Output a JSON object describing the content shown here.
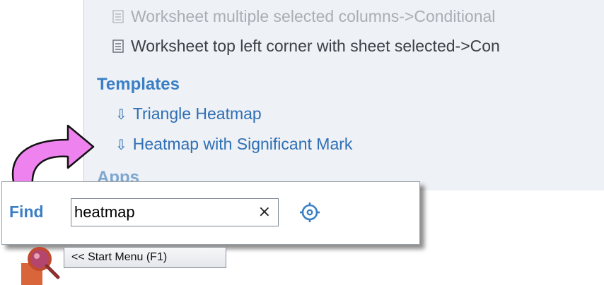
{
  "results": {
    "items": [
      {
        "label": "Worksheet multiple selected columns->Conditional",
        "icon": "document-icon",
        "state": "faded"
      },
      {
        "label": "Worksheet top left corner with sheet selected->Con",
        "icon": "document-icon"
      }
    ],
    "sections": {
      "templates": {
        "title": "Templates",
        "items": [
          {
            "glyph": "⇩",
            "label": "Triangle Heatmap",
            "icon": "download-icon"
          },
          {
            "glyph": "⇩",
            "label": "Heatmap with Significant Mark",
            "icon": "download-icon"
          }
        ]
      },
      "apps": {
        "title": "Apps"
      }
    }
  },
  "find": {
    "label": "Find",
    "value": "heatmap",
    "clear_glyph": "×",
    "settings_icon": "gear-icon"
  },
  "start_menu": {
    "label": "<< Start Menu (F1)",
    "icon": "search-magnifier-icon"
  },
  "colors": {
    "accent": "#3a7fc6",
    "link": "#2f6fb5",
    "arrow": "#ee82ee",
    "panel_bg": "#eef1f5"
  }
}
